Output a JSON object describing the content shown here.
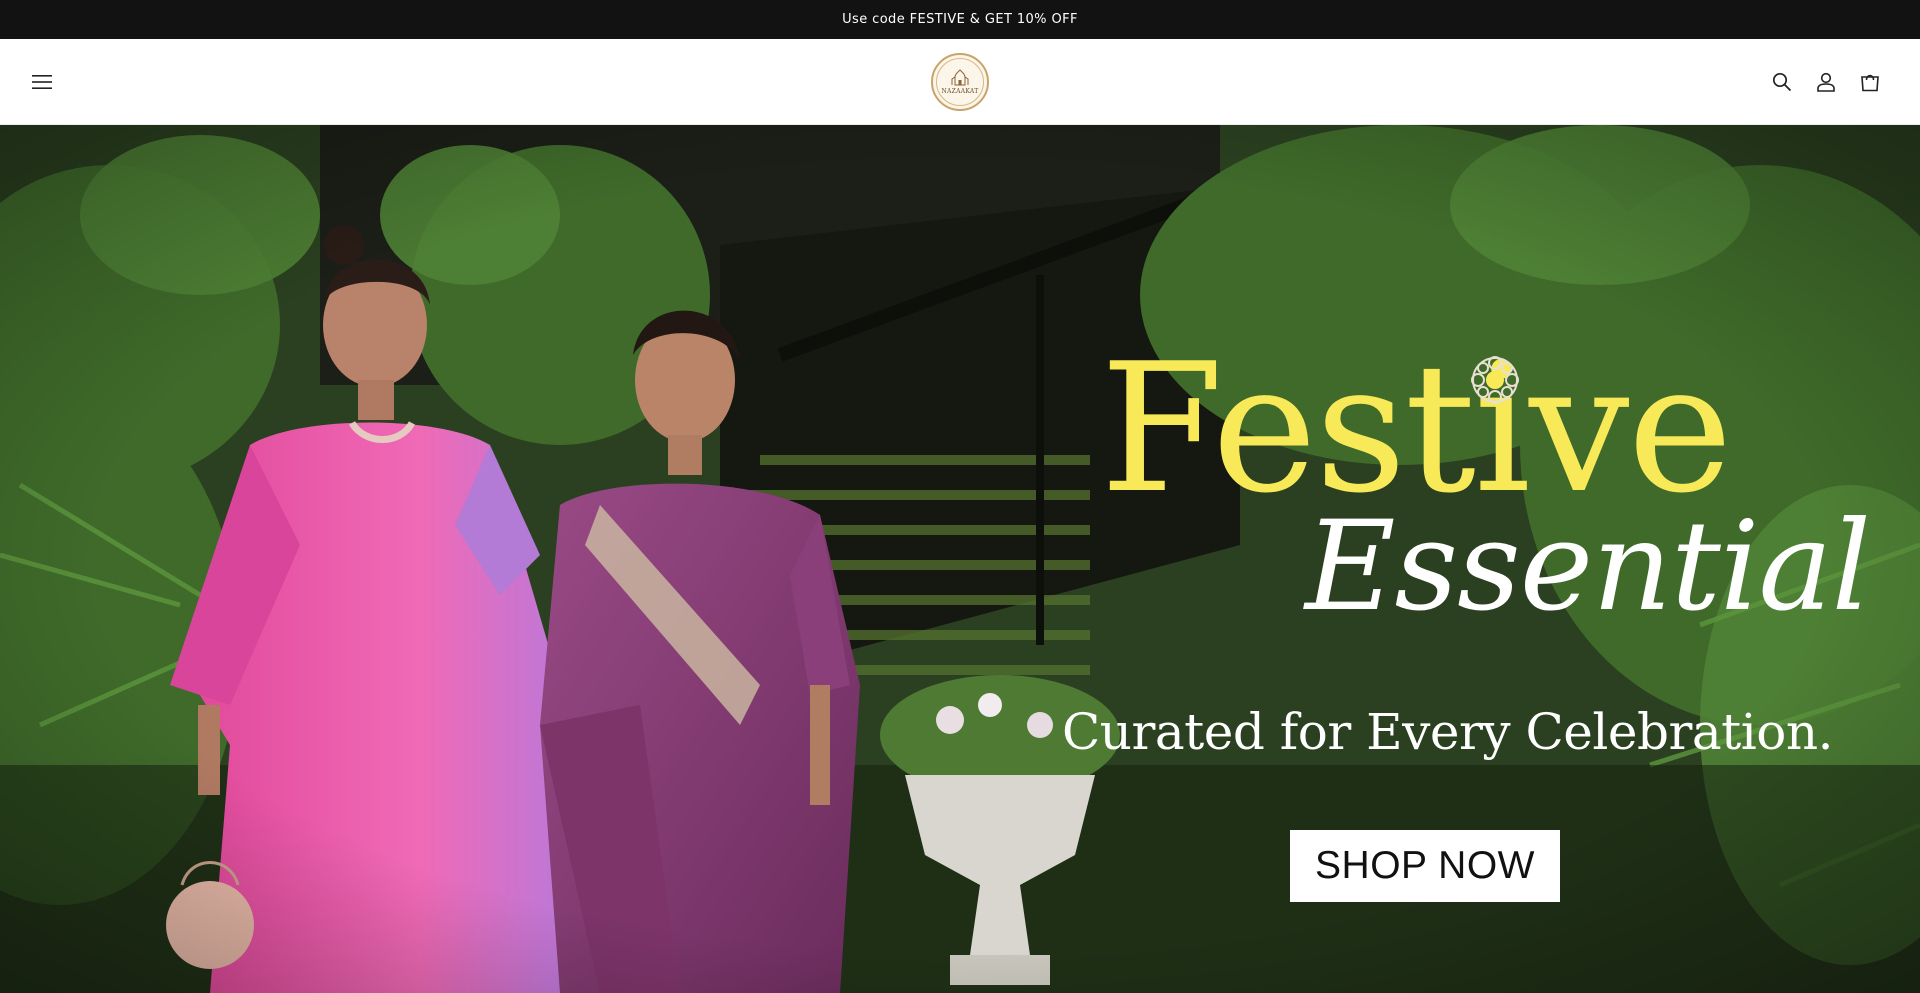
{
  "announcement": {
    "text": "Use code FESTIVE & GET 10% OFF"
  },
  "header": {
    "logo_text": "NAZAAKAT",
    "icons": [
      "menu-icon",
      "search-icon",
      "account-icon",
      "cart-icon"
    ]
  },
  "hero": {
    "headline": "Festive",
    "subheadline": "Essential",
    "tagline": "Curated for Every Celebration.",
    "cta_label": "SHOP NOW",
    "colors": {
      "headline": "#f7e957",
      "text": "#ffffff",
      "cta_bg": "#ffffff",
      "cta_text": "#111111"
    }
  },
  "colors": {
    "announcement_bg": "#121212",
    "header_bg": "#ffffff"
  }
}
